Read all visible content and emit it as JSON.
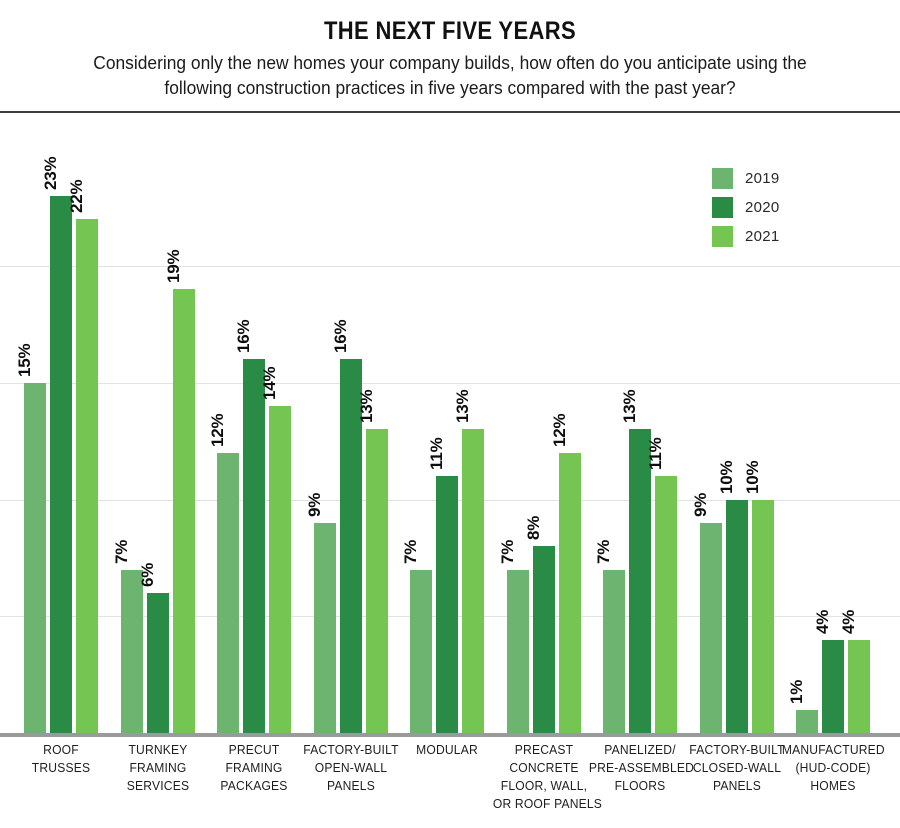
{
  "header": {
    "title": "THE NEXT FIVE YEARS",
    "subtitle": "Considering only the new homes your company builds, how often do you anticipate using the following construction practices in five years compared with the past year?"
  },
  "legend": {
    "position": "top-right",
    "entries": [
      {
        "label": "2019",
        "color": "#6db471"
      },
      {
        "label": "2020",
        "color": "#2a8b47"
      },
      {
        "label": "2021",
        "color": "#74c552"
      }
    ]
  },
  "axis": {
    "gridline_values": [
      20,
      15,
      10,
      5
    ],
    "baseline_value": 0,
    "ymax": 25
  },
  "chart_data": {
    "type": "bar",
    "title": "THE NEXT FIVE YEARS",
    "subtitle": "Considering only the new homes your company builds, how often do you anticipate using the following construction practices in five years compared with the past year?",
    "xlabel": "",
    "ylabel": "",
    "ylim": [
      0,
      25
    ],
    "grid": true,
    "value_suffix": "%",
    "legend_position": "top-right",
    "categories": [
      "ROOF TRUSSES",
      "TURNKEY FRAMING SERVICES",
      "PRECUT FRAMING PACKAGES",
      "FACTORY-BUILT OPEN-WALL PANELS",
      "MODULAR",
      "PRECAST CONCRETE FLOOR, WALL, OR ROOF PANELS",
      "PANELIZED/ PRE-ASSEMBLED FLOORS",
      "FACTORY-BUILT CLOSED-WALL PANELS",
      "MANUFACTURED (HUD-CODE) HOMES"
    ],
    "category_lines": [
      [
        "ROOF",
        "TRUSSES"
      ],
      [
        "TURNKEY",
        "FRAMING",
        "SERVICES"
      ],
      [
        "PRECUT",
        "FRAMING",
        "PACKAGES"
      ],
      [
        "FACTORY-BUILT",
        "OPEN-WALL",
        "PANELS"
      ],
      [
        "MODULAR"
      ],
      [
        "PRECAST",
        "CONCRETE",
        "FLOOR, WALL,",
        "OR ROOF PANELS"
      ],
      [
        "PANELIZED/",
        "PRE-ASSEMBLED",
        "FLOORS"
      ],
      [
        "FACTORY-BUILT",
        "CLOSED-WALL",
        "PANELS"
      ],
      [
        "MANUFACTURED",
        "(HUD-CODE)",
        "HOMES"
      ]
    ],
    "series": [
      {
        "name": "2019",
        "color": "#6db471",
        "values": [
          15,
          7,
          12,
          9,
          7,
          7,
          7,
          9,
          1
        ],
        "labels": [
          "15%",
          "7%",
          "12%",
          "9%",
          "7%",
          "7%",
          "7%",
          "9%",
          "1%"
        ]
      },
      {
        "name": "2020",
        "color": "#2a8b47",
        "values": [
          23,
          6,
          16,
          16,
          11,
          8,
          13,
          10,
          4
        ],
        "labels": [
          "23%",
          "6%",
          "16%",
          "16%",
          "11%",
          "8%",
          "13%",
          "10%",
          "4%"
        ]
      },
      {
        "name": "2021",
        "color": "#74c552",
        "values": [
          22,
          19,
          14,
          13,
          13,
          12,
          11,
          10,
          4
        ],
        "labels": [
          "22%",
          "19%",
          "14%",
          "13%",
          "13%",
          "12%",
          "11%",
          "10%",
          "4%"
        ]
      }
    ]
  }
}
